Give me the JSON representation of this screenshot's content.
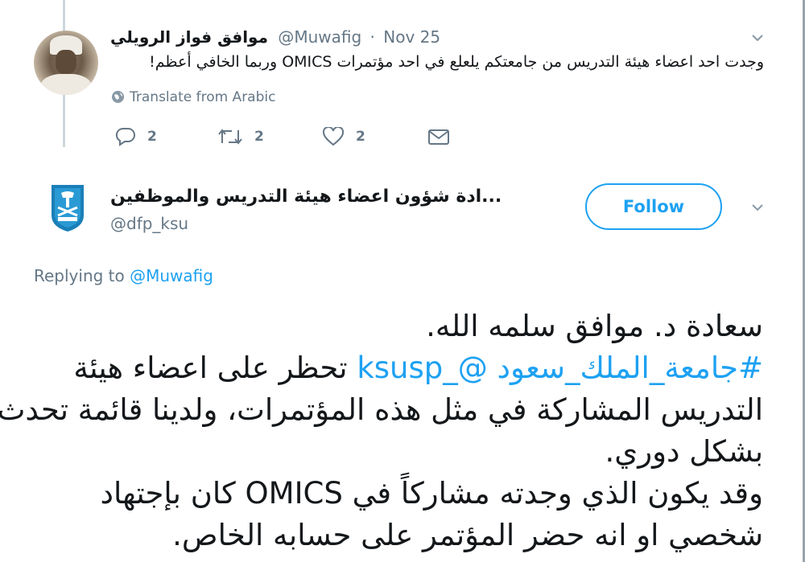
{
  "parent_tweet": {
    "display_name": "موافق فواز الرويلي",
    "handle": "@Muwafig",
    "separator": "·",
    "date": "Nov 25",
    "text": "وجدت احد اعضاء هيئة التدريس من جامعتكم يلعلع في احد مؤتمرات OMICS وربما الخافي أعظم!",
    "translate_label": "Translate from Arabic",
    "actions": {
      "reply_count": "2",
      "retweet_count": "2",
      "like_count": "2"
    }
  },
  "main_tweet": {
    "display_name": "...ادة شؤون اعضاء هيئة التدريس والموظفين",
    "handle": "@dfp_ksu",
    "follow_label": "Follow",
    "replying_prefix": "Replying to",
    "replying_to": "@Muwafig",
    "lines": {
      "l1": "سعادة د. موافق سلمه الله.",
      "l2_hashtag": "#جامعة_الملك_سعود",
      "l2_mention": "@_ksusp",
      "l2_text": "تحظر على اعضاء هيئة",
      "l3": "التدريس المشاركة في مثل هذه المؤتمرات، ولدينا قائمة تحدث",
      "l4": "بشكل دوري.",
      "l5": "وقد يكون الذي وجدته مشاركاً في OMICS  كان بإجتهاد",
      "l6": "شخصي او انه حضر المؤتمر على حسابه الخاص."
    }
  },
  "colors": {
    "accent": "#1da1f2",
    "muted": "#657786",
    "text": "#14171a",
    "divider": "#ccd6dd"
  },
  "icons": [
    "chevron-down-icon",
    "globe-icon",
    "reply-icon",
    "retweet-icon",
    "like-icon",
    "message-icon",
    "ksu-logo"
  ]
}
